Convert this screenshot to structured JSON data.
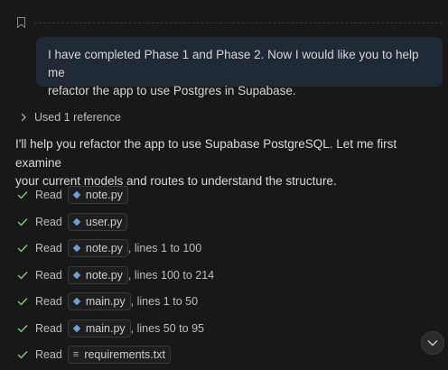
{
  "user_message": {
    "line1": "I have completed Phase 1 and Phase 2. Now I would like you to help me",
    "line2": "refactor the app to use Postgres in Supabase."
  },
  "references": {
    "label": "Used 1 reference"
  },
  "response": {
    "line1": "I'll help you refactor the app to use Supabase PostgreSQL. Let me first examine",
    "line2": "your current models and routes to understand the structure."
  },
  "steps": [
    {
      "action": "Read",
      "file": "note.py",
      "icon": "python-file-icon",
      "suffix": ""
    },
    {
      "action": "Read",
      "file": "user.py",
      "icon": "python-file-icon",
      "suffix": ""
    },
    {
      "action": "Read",
      "file": "note.py",
      "icon": "python-file-icon",
      "suffix": ", lines 1 to 100"
    },
    {
      "action": "Read",
      "file": "note.py",
      "icon": "python-file-icon",
      "suffix": ", lines 100 to 214"
    },
    {
      "action": "Read",
      "file": "main.py",
      "icon": "python-file-icon",
      "suffix": ", lines 1 to 50"
    },
    {
      "action": "Read",
      "file": "main.py",
      "icon": "python-file-icon",
      "suffix": ", lines 50 to 95"
    },
    {
      "action": "Read",
      "file": "requirements.txt",
      "icon": "text-file-icon",
      "suffix": ""
    }
  ],
  "colors": {
    "background": "#181818",
    "user_bubble": "#1f2a36",
    "check_green": "#89d185",
    "python_icon": "#6fa0d8"
  }
}
